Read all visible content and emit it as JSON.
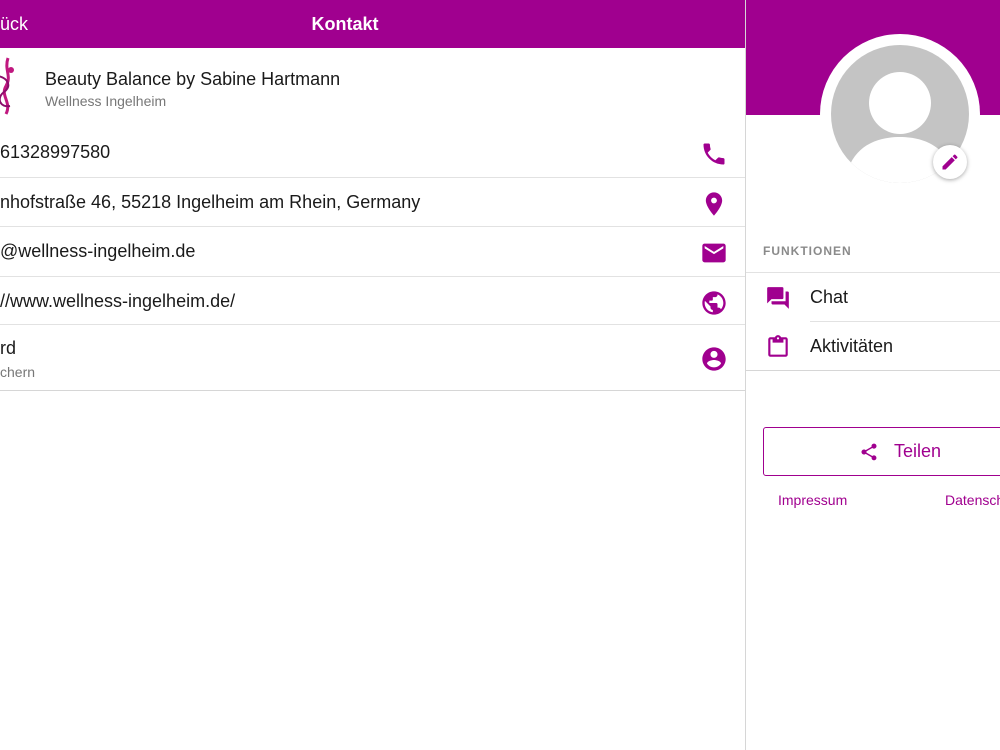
{
  "header": {
    "back_label": "ück",
    "title": "Kontakt"
  },
  "profile": {
    "name": "Beauty Balance by Sabine Hartmann",
    "subtitle": "Wellness Ingelheim"
  },
  "contact_rows": {
    "phone": "61328997580",
    "address": "nhofstraße 46, 55218 Ingelheim am Rhein, Germany",
    "email": "@wellness-ingelheim.de",
    "website": "//www.wellness-ingelheim.de/",
    "card_title": "rd",
    "card_subtitle": "chern"
  },
  "icons": {
    "phone": "phone-icon",
    "address": "map-pin-icon",
    "email": "envelope-icon",
    "website": "globe-icon",
    "card": "account-circle-icon",
    "edit": "pencil-icon",
    "chat": "chat-icon",
    "activities": "clipboard-icon",
    "share": "share-icon"
  },
  "sidebar": {
    "section_title": "FUNKTIONEN",
    "items": [
      {
        "label": "Chat"
      },
      {
        "label": "Aktivitäten"
      }
    ],
    "share_label": "Teilen",
    "imprint_label": "Impressum",
    "privacy_label": "Datensch"
  },
  "colors": {
    "accent": "#a0008f",
    "avatar_gray": "#c4c4c4"
  }
}
